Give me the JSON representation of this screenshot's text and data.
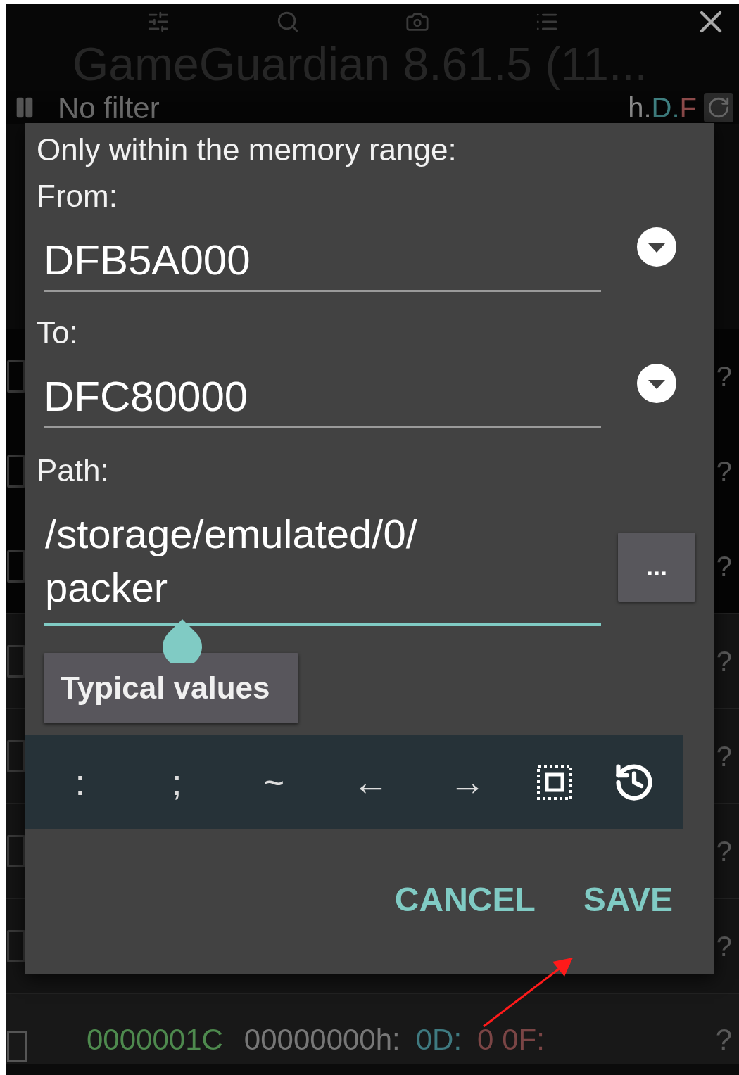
{
  "app_bar": {
    "title": "GameGuardian 8.61.5 (11..."
  },
  "filter_bar": {
    "label": "No filter",
    "flags": [
      {
        "text": "h.",
        "color": "#8a8a8a"
      },
      {
        "text": "D.",
        "color": "#3f7f80"
      },
      {
        "text": "F",
        "color": "#8c4a4a"
      }
    ]
  },
  "list_rows": [
    {
      "checked": false,
      "value": "?"
    },
    {
      "checked": false,
      "value": "?"
    },
    {
      "checked": false,
      "value": "?"
    },
    {
      "checked": false,
      "value": "?"
    },
    {
      "checked": false,
      "value": "?"
    },
    {
      "checked": false,
      "value": "?"
    },
    {
      "checked": false,
      "value": "?"
    }
  ],
  "bottom_row": {
    "checked": false,
    "address": "0000001C",
    "hex": "00000000h:",
    "dword": "0D:",
    "float": "0 0F:",
    "value": "?"
  },
  "dialog": {
    "heading": "Only within the memory range:",
    "from": {
      "label": "From:",
      "value": "DFB5A000"
    },
    "to": {
      "label": "To:",
      "value": "DFC80000"
    },
    "path": {
      "label": "Path:",
      "value": "/storage/emulated/0/packer",
      "browse": "..."
    },
    "typical_button": "Typical values",
    "keys": [
      {
        "kind": "char",
        "text": ":"
      },
      {
        "kind": "char",
        "text": ";"
      },
      {
        "kind": "char",
        "text": "~"
      },
      {
        "kind": "char",
        "text": "←"
      },
      {
        "kind": "char",
        "text": "→"
      },
      {
        "kind": "select"
      },
      {
        "kind": "history"
      }
    ],
    "buttons": [
      "CANCEL",
      "SAVE"
    ]
  }
}
